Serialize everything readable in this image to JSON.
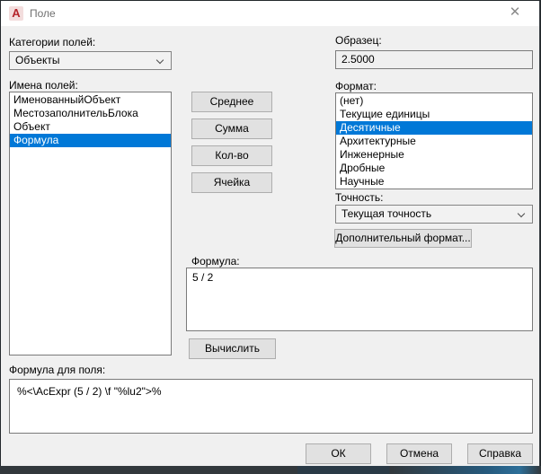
{
  "title_bar": {
    "title": "Поле",
    "app_icon_glyph": "A",
    "close_glyph": "✕"
  },
  "left": {
    "categories_label": "Категории полей:",
    "categories_value": "Объекты",
    "names_label": "Имена полей:",
    "field_names": [
      "ИменованныйОбъект",
      "МестозаполнительБлока",
      "Объект",
      "Формула"
    ],
    "selected_field_name": "Формула"
  },
  "middle": {
    "buttons": [
      "Среднее",
      "Сумма",
      "Кол-во",
      "Ячейка"
    ],
    "formula_label": "Формула:",
    "formula_value": "5 / 2",
    "evaluate_button": "Вычислить"
  },
  "right": {
    "sample_label": "Образец:",
    "sample_value": "2.5000",
    "format_label": "Формат:",
    "formats": [
      "(нет)",
      "Текущие единицы",
      "Десятичные",
      "Архитектурные",
      "Инженерные",
      "Дробные",
      "Научные"
    ],
    "selected_format": "Десятичные",
    "precision_label": "Точность:",
    "precision_value": "Текущая точность",
    "additional_format_button": "Дополнительный формат..."
  },
  "bottom": {
    "field_expression_label": "Формула для поля:",
    "field_expression_value": "%<\\AcExpr (5 / 2) \\f \"%lu2\">%",
    "ok_button": "ОК",
    "cancel_button": "Отмена",
    "help_button": "Справка"
  },
  "colors": {
    "selection_blue": "#0078d7",
    "autocad_red": "#b5232a",
    "dialog_background": "#f0f0f0"
  }
}
